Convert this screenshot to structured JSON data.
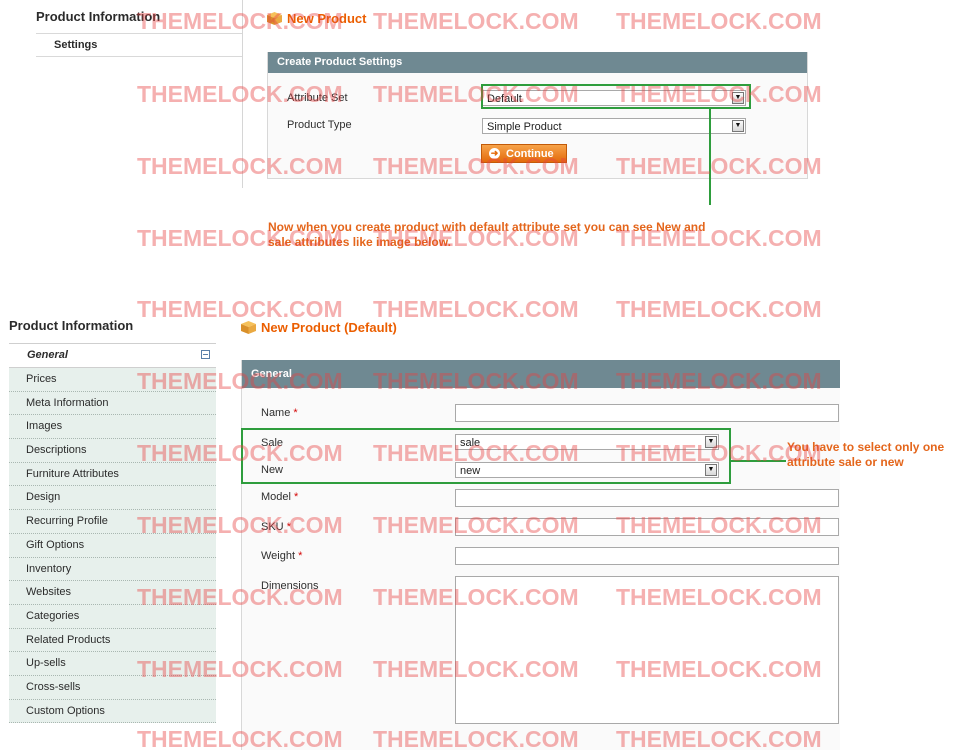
{
  "top": {
    "sidebar_title": "Product Information",
    "sidebar_tab": "Settings",
    "page_title": "New Product",
    "box_title": "Create Product Settings",
    "attribute_set_label": "Attribute Set",
    "attribute_set_value": "Default",
    "product_type_label": "Product Type",
    "product_type_value": "Simple Product",
    "continue_label": "Continue"
  },
  "annotation_top": "Now when you create product with default attribute set you can see New and sale attributes like image below.",
  "bottom": {
    "sidebar_title": "Product Information",
    "general_tab": "General",
    "sidebar_items": [
      "Prices",
      "Meta Information",
      "Images",
      "Descriptions",
      "Furniture Attributes",
      "Design",
      "Recurring Profile",
      "Gift Options",
      "Inventory",
      "Websites",
      "Categories",
      "Related Products",
      "Up-sells",
      "Cross-sells",
      "Custom Options"
    ],
    "page_title": "New Product (Default)",
    "box_title": "General",
    "name_label": "Name",
    "sale_label": "Sale",
    "sale_value": "sale",
    "new_label": "New",
    "new_value": "new",
    "model_label": "Model",
    "sku_label": "SKU",
    "weight_label": "Weight",
    "dimensions_label": "Dimensions",
    "required_mark": "*"
  },
  "annotation_bottom": "You have to select only one attribute sale or new",
  "watermark": "THEMELOCK.COM",
  "colors": {
    "accent": "#eb5e00",
    "header_bar": "#6f8992",
    "highlight": "#2e9d3d",
    "annotation": "#e4661c",
    "watermark": "#e84242"
  }
}
